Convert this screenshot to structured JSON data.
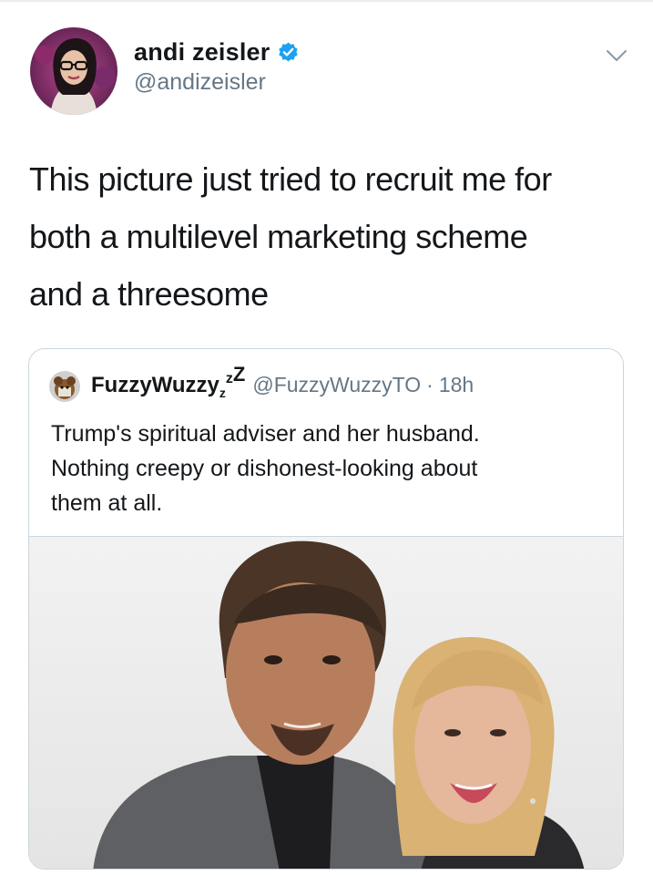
{
  "tweet": {
    "author": {
      "display_name": "andi zeisler",
      "handle": "@andizeisler",
      "verified_icon": "verified-badge-icon",
      "avatar_icon": "avatar"
    },
    "more_icon": "chevron-down-icon",
    "text": "This picture just tried to recruit me for\nboth a multilevel marketing scheme\nand a threesome"
  },
  "quoted_tweet": {
    "display_name": "FuzzyWuzzy",
    "name_suffix_sub": "z",
    "name_suffix_sup": "z",
    "name_suffix_big": "Z",
    "handle": "@FuzzyWuzzyTO",
    "separator": "·",
    "timestamp": "18h",
    "text": "Trump's spiritual adviser and her husband.\nNothing creepy or dishonest-looking about\nthem at all.",
    "media_icon": "photo"
  },
  "colors": {
    "text": "#14171a",
    "secondary": "#657786",
    "border": "#ccd6dd",
    "verified": "#1da1f2"
  }
}
